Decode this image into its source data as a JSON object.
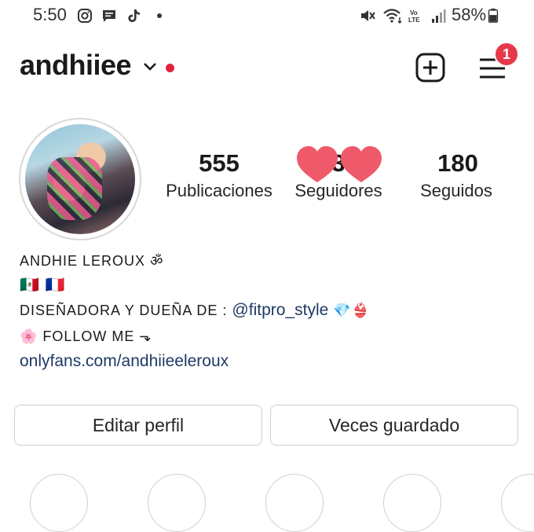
{
  "status_bar": {
    "time": "5:50",
    "battery_percent": "58%",
    "notification_icons": [
      "instagram-icon",
      "message-icon",
      "tiktok-icon",
      "dot-icon"
    ],
    "system_icons": [
      "mute-icon",
      "wifi-icon",
      "volte-icon",
      "signal-icon",
      "battery-icon"
    ]
  },
  "header": {
    "username": "andhiiee",
    "menu_badge": "1"
  },
  "stats": {
    "posts_count": "555",
    "posts_label": "Publicaciones",
    "followers_count": "3",
    "followers_label": "Seguidores",
    "following_count": "180",
    "following_label": "Seguidos"
  },
  "bio": {
    "name": "ANDHIE LEROUX ॐ",
    "flags": "🇲🇽 🇫🇷",
    "line3_prefix": "DISEÑADORA Y DUEÑA DE : ",
    "handle": "@fitpro_style",
    "line3_suffix": " 💎👙",
    "line4": "🌸 FOLLOW ME ⬎",
    "link": "onlyfans.com/andhiieeleroux"
  },
  "buttons": {
    "edit": "Editar perfil",
    "saved": "Veces guardado"
  },
  "colors": {
    "badge": "#e6384a",
    "online_dot": "#e0243c",
    "link": "#1e3a66",
    "hearts": "#ef5a6b"
  }
}
